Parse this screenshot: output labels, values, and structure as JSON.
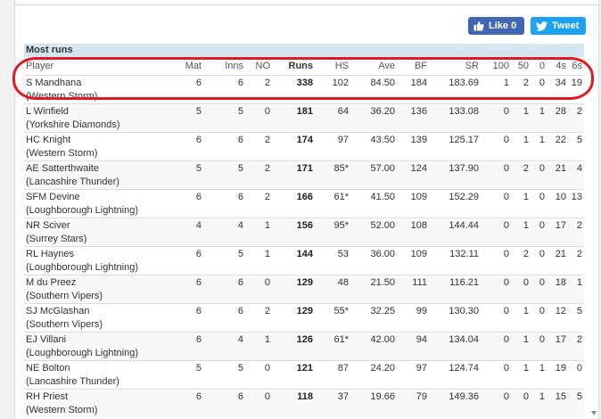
{
  "social": {
    "like_label": "Like 0",
    "tweet_label": "Tweet",
    "facebook_color": "#4267b2",
    "twitter_color": "#1da1f2"
  },
  "section": {
    "title": "Most runs"
  },
  "columns": [
    "Player",
    "Mat",
    "Inns",
    "NO",
    "Runs",
    "HS",
    "Ave",
    "BF",
    "SR",
    "100",
    "50",
    "0",
    "4s",
    "6s"
  ],
  "rows": [
    {
      "name": "S Mandhana",
      "team": "(Western Storm)",
      "mat": "6",
      "inns": "6",
      "no": "2",
      "runs": "338",
      "hs": "102",
      "ave": "84.50",
      "bf": "184",
      "sr": "183.69",
      "hundreds": "1",
      "fifties": "2",
      "ducks": "0",
      "fours": "34",
      "sixes": "19"
    },
    {
      "name": "L Winfield",
      "team": "(Yorkshire Diamonds)",
      "mat": "5",
      "inns": "5",
      "no": "0",
      "runs": "181",
      "hs": "64",
      "ave": "36.20",
      "bf": "136",
      "sr": "133.08",
      "hundreds": "0",
      "fifties": "1",
      "ducks": "1",
      "fours": "28",
      "sixes": "2"
    },
    {
      "name": "HC Knight",
      "team": "(Western Storm)",
      "mat": "6",
      "inns": "6",
      "no": "2",
      "runs": "174",
      "hs": "97",
      "ave": "43.50",
      "bf": "139",
      "sr": "125.17",
      "hundreds": "0",
      "fifties": "1",
      "ducks": "1",
      "fours": "22",
      "sixes": "5"
    },
    {
      "name": "AE Satterthwaite",
      "team": "(Lancashire Thunder)",
      "mat": "5",
      "inns": "5",
      "no": "2",
      "runs": "171",
      "hs": "85*",
      "ave": "57.00",
      "bf": "124",
      "sr": "137.90",
      "hundreds": "0",
      "fifties": "2",
      "ducks": "0",
      "fours": "21",
      "sixes": "4"
    },
    {
      "name": "SFM Devine",
      "team": "(Loughborough Lightning)",
      "mat": "6",
      "inns": "6",
      "no": "2",
      "runs": "166",
      "hs": "61*",
      "ave": "41.50",
      "bf": "109",
      "sr": "152.29",
      "hundreds": "0",
      "fifties": "1",
      "ducks": "0",
      "fours": "10",
      "sixes": "13"
    },
    {
      "name": "NR Sciver",
      "team": "(Surrey Stars)",
      "mat": "4",
      "inns": "4",
      "no": "1",
      "runs": "156",
      "hs": "95*",
      "ave": "52.00",
      "bf": "108",
      "sr": "144.44",
      "hundreds": "0",
      "fifties": "1",
      "ducks": "0",
      "fours": "17",
      "sixes": "2"
    },
    {
      "name": "RL Haynes",
      "team": "(Loughborough Lightning)",
      "mat": "6",
      "inns": "5",
      "no": "1",
      "runs": "144",
      "hs": "53",
      "ave": "36.00",
      "bf": "109",
      "sr": "132.11",
      "hundreds": "0",
      "fifties": "2",
      "ducks": "0",
      "fours": "21",
      "sixes": "2"
    },
    {
      "name": "M du Preez",
      "team": "(Southern Vipers)",
      "mat": "6",
      "inns": "6",
      "no": "0",
      "runs": "129",
      "hs": "48",
      "ave": "21.50",
      "bf": "111",
      "sr": "116.21",
      "hundreds": "0",
      "fifties": "0",
      "ducks": "0",
      "fours": "18",
      "sixes": "1"
    },
    {
      "name": "SJ McGlashan",
      "team": "(Southern Vipers)",
      "mat": "6",
      "inns": "6",
      "no": "2",
      "runs": "129",
      "hs": "55*",
      "ave": "32.25",
      "bf": "99",
      "sr": "130.30",
      "hundreds": "0",
      "fifties": "1",
      "ducks": "0",
      "fours": "12",
      "sixes": "5"
    },
    {
      "name": "EJ Villani",
      "team": "(Loughborough Lightning)",
      "mat": "6",
      "inns": "4",
      "no": "1",
      "runs": "126",
      "hs": "61*",
      "ave": "42.00",
      "bf": "94",
      "sr": "134.04",
      "hundreds": "0",
      "fifties": "1",
      "ducks": "0",
      "fours": "17",
      "sixes": "2"
    },
    {
      "name": "NE Bolton",
      "team": "(Lancashire Thunder)",
      "mat": "5",
      "inns": "5",
      "no": "0",
      "runs": "121",
      "hs": "87",
      "ave": "24.20",
      "bf": "97",
      "sr": "124.74",
      "hundreds": "0",
      "fifties": "1",
      "ducks": "1",
      "fours": "19",
      "sixes": "0"
    },
    {
      "name": "RH Priest",
      "team": "(Western Storm)",
      "mat": "6",
      "inns": "6",
      "no": "0",
      "runs": "118",
      "hs": "37",
      "ave": "19.66",
      "bf": "79",
      "sr": "149.36",
      "hundreds": "0",
      "fifties": "0",
      "ducks": "1",
      "fours": "15",
      "sixes": "5"
    }
  ],
  "highlight_color": "#e01b24"
}
